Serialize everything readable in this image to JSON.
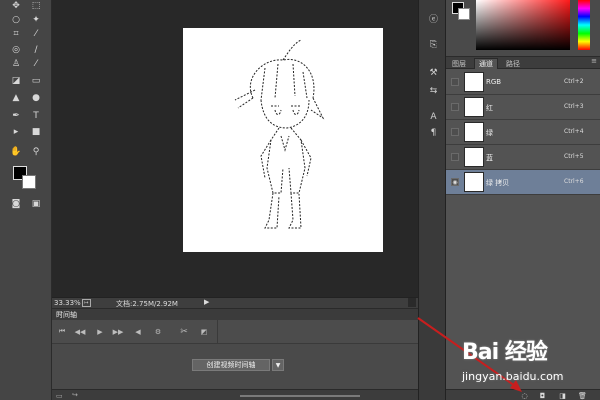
{
  "status": {
    "zoom": "33.33%",
    "doc_info": "文档:2.75M/2.92M"
  },
  "timeline": {
    "tab_label": "时间轴",
    "create_button": "创建视频时间轴"
  },
  "panels": {
    "tabs": [
      "图层",
      "通道",
      "路径"
    ],
    "active_tab": "通道",
    "channels": [
      {
        "name": "RGB",
        "shortcut": "Ctrl+2",
        "visible": false,
        "selected": false
      },
      {
        "name": "红",
        "shortcut": "Ctrl+3",
        "visible": false,
        "selected": false
      },
      {
        "name": "绿",
        "shortcut": "Ctrl+4",
        "visible": false,
        "selected": false
      },
      {
        "name": "蓝",
        "shortcut": "Ctrl+5",
        "visible": false,
        "selected": false
      },
      {
        "name": "绿 拷贝",
        "shortcut": "Ctrl+6",
        "visible": true,
        "selected": true
      }
    ]
  },
  "colors": {
    "foreground": "#000000",
    "background": "#ffffff",
    "selection_highlight": "#6e7f98",
    "annotation_arrow": "#c81e1e"
  },
  "watermark": {
    "logo": "Bai 经验",
    "url": "jingyan.baidu.com"
  },
  "icons": {
    "tools": [
      "move-icon",
      "marquee-icon",
      "lasso-icon",
      "magic-wand-icon",
      "crop-icon",
      "eyedropper-icon",
      "spot-heal-icon",
      "brush-icon",
      "stamp-icon",
      "history-brush-icon",
      "eraser-icon",
      "gradient-icon",
      "blur-icon",
      "dodge-icon",
      "pen-icon",
      "type-icon",
      "path-select-icon",
      "shape-icon",
      "hand-icon",
      "zoom-icon"
    ]
  }
}
